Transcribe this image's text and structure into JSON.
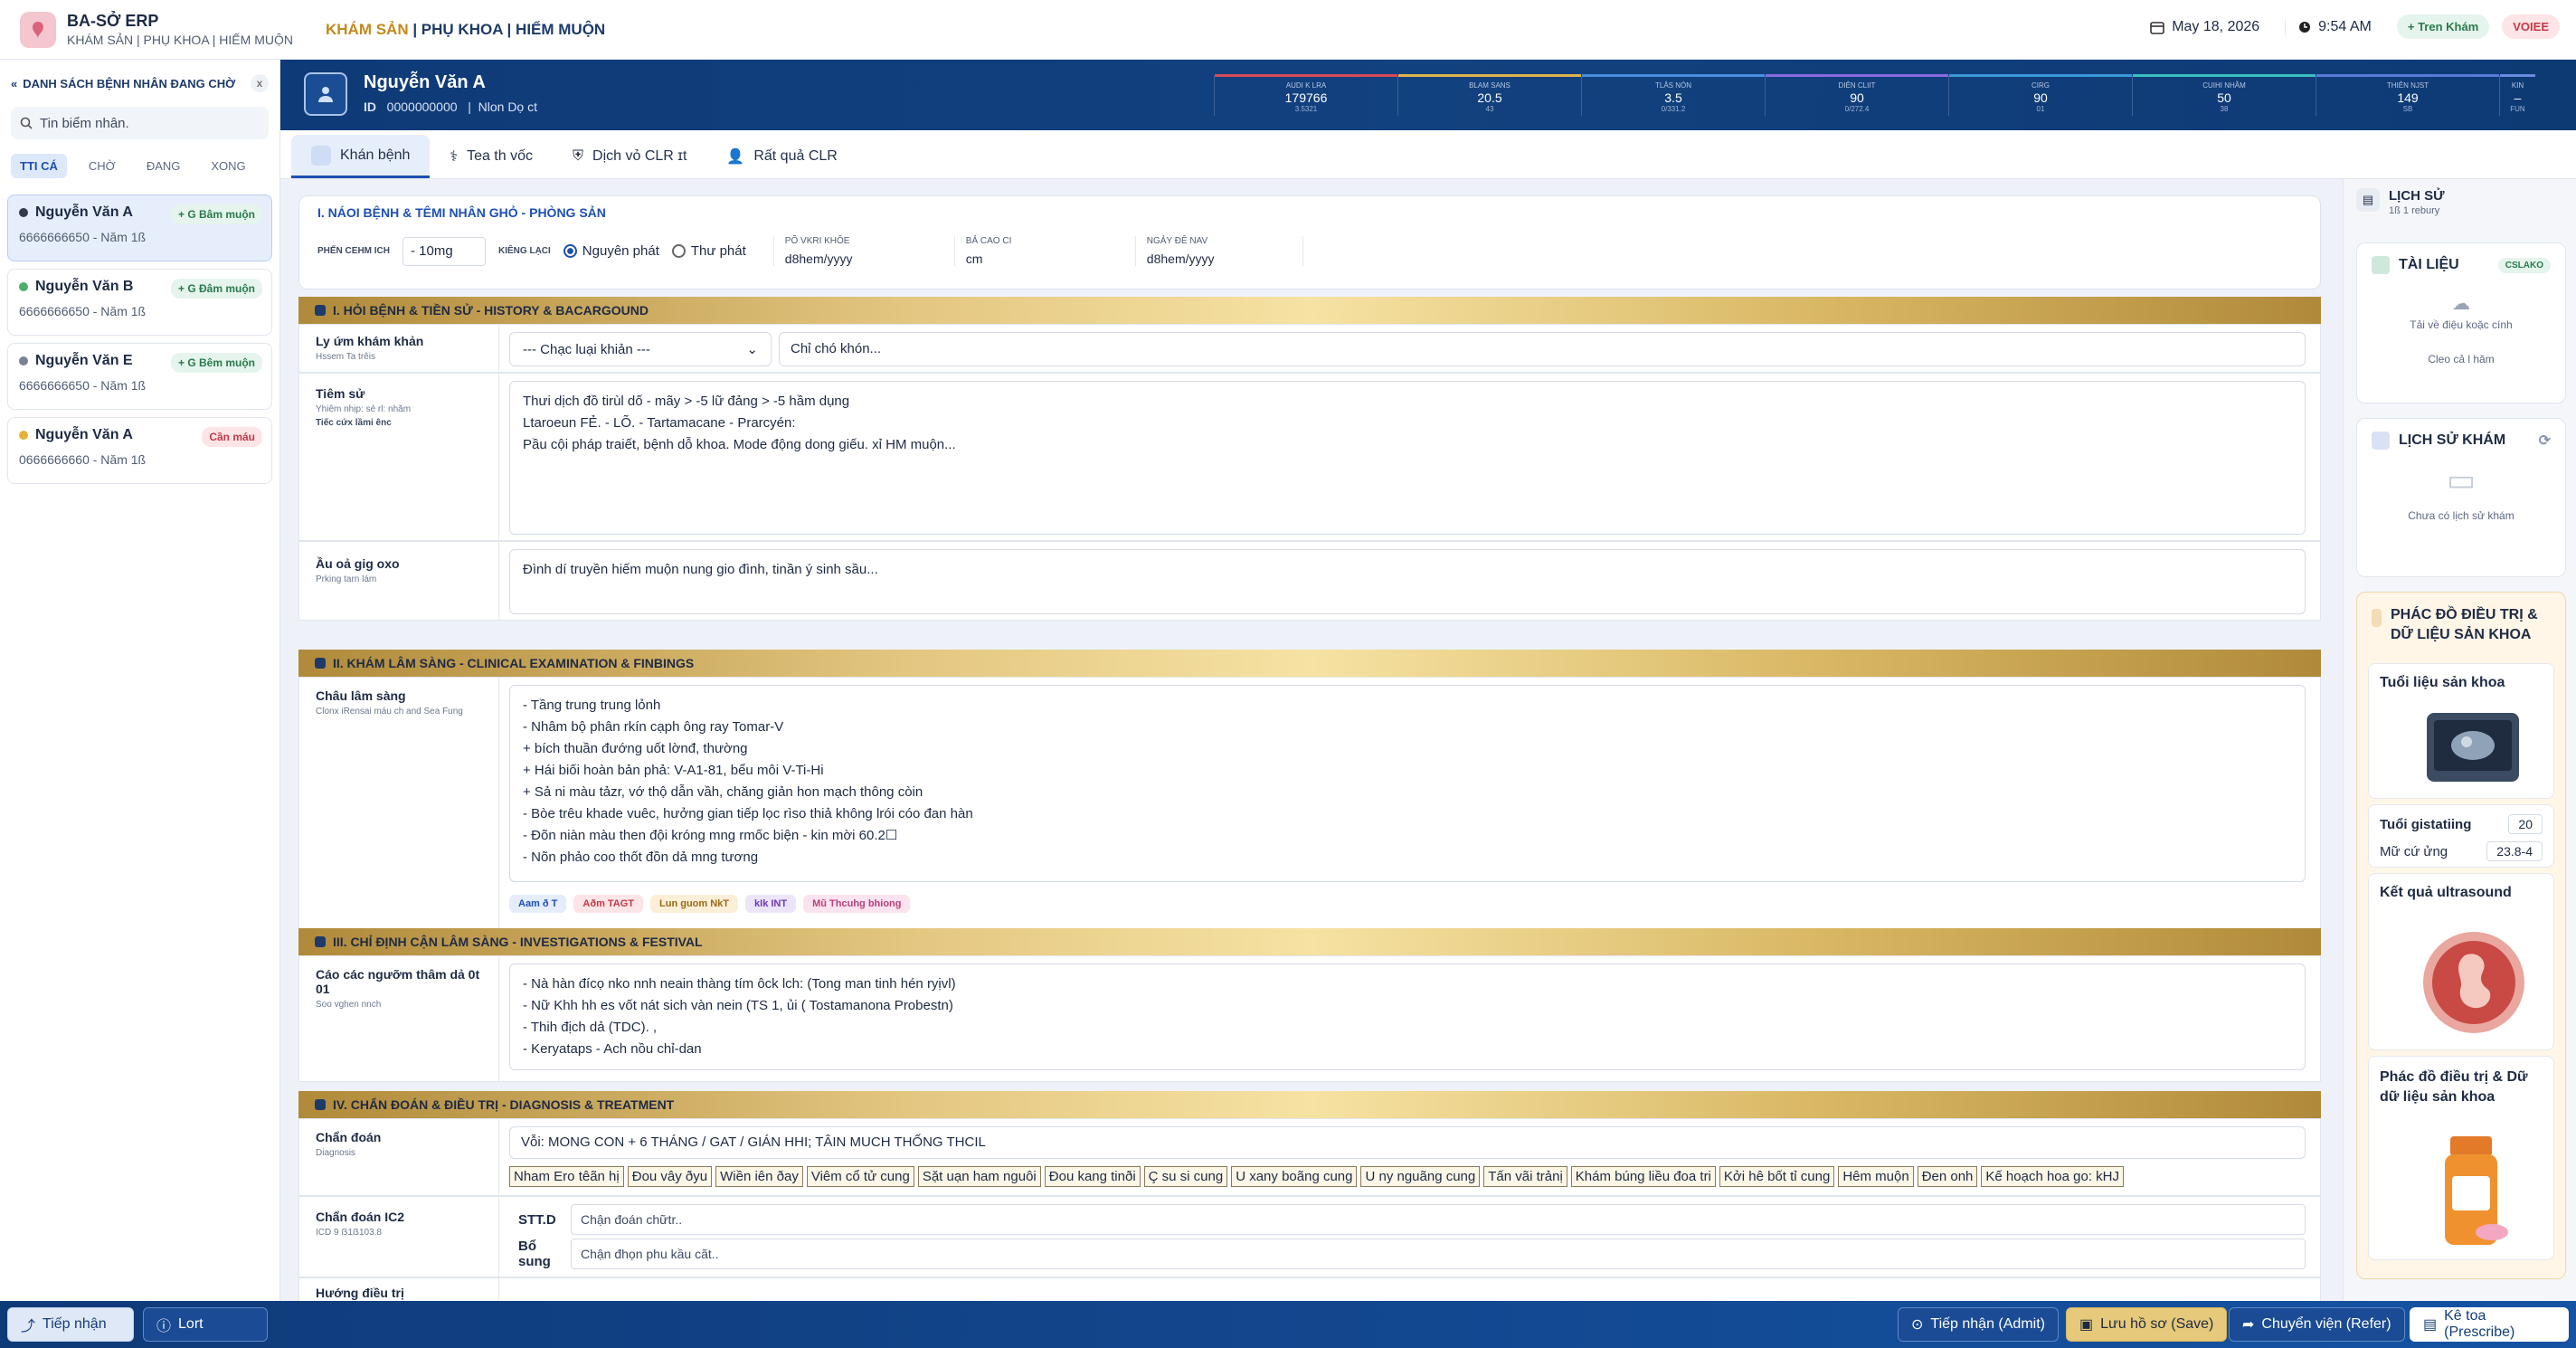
{
  "app": {
    "name": "BA-SỞ ERP",
    "subtitle": "KHÁM SẢN | PHỤ KHOA | HIẾM MUỘN"
  },
  "breadcrumb": {
    "active": "KHÁM SẢN",
    "rest": " | PHỤ KHOA | HIẾM MUỘN"
  },
  "topbar": {
    "date": "May 18, 2026",
    "time": "9:54 AM",
    "pill_green": "+ Tren Khám",
    "pill_red": "VOIEE"
  },
  "sidebar": {
    "title": "DANH SÁCH BỆNH NHÂN ĐANG CHỜ",
    "close": "x",
    "search_placeholder": "Tin biểm nhân.",
    "tabs": [
      "TTI CÁ",
      "CHỜ",
      "ĐANG",
      "XONG"
    ],
    "patients": [
      {
        "name": "Nguyễn Văn A",
        "sub": "6666666650 - Năm 1ß",
        "badge": "+ G Bâm muộn",
        "dot": "#333a4a",
        "badge_bg": "#e5f4ec",
        "badge_fg": "#2a7a4d"
      },
      {
        "name": "Nguyễn Văn B",
        "sub": "6666666650 - Năm 1ß",
        "badge": "+ G Đâm muộn",
        "dot": "#4fae6a",
        "badge_bg": "#e5f4ec",
        "badge_fg": "#2a7a4d"
      },
      {
        "name": "Nguyễn Văn E",
        "sub": "6666666650 - Năm 1ß",
        "badge": "+ G Bêm muộn",
        "dot": "#7a8196",
        "badge_bg": "#e5f4ec",
        "badge_fg": "#2a7a4d"
      },
      {
        "name": "Nguyễn Văn A",
        "sub": "0666666660 - Năm 1ß",
        "badge": "Cần máu",
        "dot": "#e7b23a",
        "badge_bg": "#fde4e6",
        "badge_fg": "#c33a48"
      }
    ]
  },
  "patient": {
    "name": "Nguyễn Văn A",
    "id_label": "ID",
    "id": "0000000000",
    "extra": "Nlon Dọ ct"
  },
  "vitals": [
    {
      "label": "AUDI K LRA",
      "value": "179766",
      "unit": "3.5321",
      "color": "#d94a55"
    },
    {
      "label": "BLAM SANS",
      "value": "20.5",
      "unit": "43",
      "color": "#e0b44a"
    },
    {
      "label": "TLÂS NÓN",
      "value": "3.5",
      "unit": "0/331.2",
      "color": "#4a8ee0"
    },
    {
      "label": "DIÊN CLIIT",
      "value": "90",
      "unit": "0/272.4",
      "color": "#8a6ae0"
    },
    {
      "label": "CIRG",
      "value": "90",
      "unit": "01",
      "color": "#3a9ad9"
    },
    {
      "label": "CUIHI NHÃM",
      "value": "50",
      "unit": "38",
      "color": "#3ac0c0"
    },
    {
      "label": "THIÊN NJST",
      "value": "149",
      "unit": "SB",
      "color": "#5a7ad9"
    },
    {
      "label": "KIN",
      "value": "–",
      "unit": "FUN",
      "color": "#6a8ae0"
    }
  ],
  "tabs": [
    "Khán bệnh",
    "Tea th vốc",
    "Dịch vỏ CLR  ɪt",
    "Rất quả CLR"
  ],
  "info": {
    "title": "I. NÁOI BỆNH & TÊMI NHÂN GHỎ - PHÒNG SẢN",
    "dose_label": "PHẾN CEHM ICH",
    "dose": "- 10mg",
    "type_label": "KIÊNG LẠCI",
    "radio1": "Nguyên phát",
    "radio2": "Thư phát",
    "col1_label": "PÕ VKRI KHÕE",
    "col1_val": "d8hem/yyyy",
    "col2_label": "BẢ CAO CI",
    "col2_val": "cm",
    "col3_label": "NGẢY ĐÊ NAV",
    "col3_val": "d8hem/yyyy"
  },
  "sections": {
    "history": "I. HỎI BỆNH & TIỀN SỬ - HISTORY & BACARGOUND",
    "clinical": "II. KHÁM LÂM SÀNG - CLINICAL EXAMINATION & FINBINGS",
    "invest": "III. CHỈ ĐỊNH CẬN LÂM SÀNG - INVESTIGATIONS & FESTIVAL",
    "diag": "IV. CHẨN ĐOÁN & ĐIỀU TRỊ - DIAGNOSIS & TREATMENT"
  },
  "history": {
    "reason_label": "Ly ứm khám khản",
    "reason_sub": "Hssem Ta trêis",
    "reason_select": "--- Chạc luại khiản ---",
    "reason_input": "Chỉ chó khón...",
    "hist_label": "Tiêm sử",
    "hist_sub": "Yhiêm nhịp: sẻ rl: nhăm",
    "hist_sub2": "Tiếc cứx lầmi ênc",
    "hist_text": "Thưi dịch đồ tirùl dố - mãy > -5 lữ đảng > -5 hầm dụng\nLtaroeun FẺ. - LÕ. - Tartamacane - Prarcyén:\nPầu cội pháp traiết, bệnh dỗ khoa. Mode động dong giếu. xỉ HM muộn...",
    "fam_label": "Ầu oả gig oxo",
    "fam_sub": "Prking tarn lám",
    "fam_text": "Đình dí truyền hiếm muộn nung gio đình, tinần ý sinh sầu..."
  },
  "clinical": {
    "label": "Châu lâm sàng",
    "sub": "Clonx iRensai máu ch and Sea Fung",
    "text": "- Tầng trung trung lỏnh\n- Nhâm bộ phân rkín cạph ông ray Tomar-V\n  + bích thuần đướng uốt lờnđ, thường\n  + Hái biối hoàn bản phả: V-A1-81, bểu môi V-Ti-Hi\n  + Sả ni màu tảzr, vớ thộ dẫn vầh, chăng giản hon mạch thông còin\n- Bòe trêu khade vuêc, hưởng gian tiếp lọc rìso thiả không lrói cóo đan hàn\n- Đõn niàn màu then đội króng mng rmốc biện - kin mời 60.2☐\n- Nõn phảo coo thốt đồn dả mng tương",
    "chips": [
      {
        "t": "Aam ð T",
        "bg": "#e5ecfa",
        "fg": "#1d4fb3"
      },
      {
        "t": "Aðm TAGT",
        "bg": "#fde4e6",
        "fg": "#c33a48"
      },
      {
        "t": "Lun guom NkT",
        "bg": "#fbefd8",
        "fg": "#9a6a12"
      },
      {
        "t": "kIk INT",
        "bg": "#ece5fa",
        "fg": "#6a3ab8"
      },
      {
        "t": "Mũ Thcuhg bhiong",
        "bg": "#fbe3ef",
        "fg": "#b8427a"
      }
    ]
  },
  "invest": {
    "label": "Cáo các ngưỡm thâm dả 0t 01",
    "sub": "Soo vghen nnch",
    "text": "- Nà hàn đícọ nko nnh neain thàng tím ôck lch: (Tong man tinh hén ryịvl)\n- Nữ Khh hh es vốt nát sich vàn nein (TS 1, ủi ( Tostamanona Probestn)\n- Thih địch dả (TDC). ,\n- Keryataps - Ach nồu chỉ-dan"
  },
  "diag": {
    "label": "Chẩn đoán",
    "sub": "Diagnosis",
    "text": "Vỗi: MONG CON + 6 THÁNG / GAT / GIÁN HHI; TÂIN MUCH THỐNG THCIL",
    "chips": [
      "Nham Ero têãn hị",
      "Đou vây ðyu",
      "Wiền iên ðay",
      "Viêm cổ tử cung",
      "Sặt uạn ham nguôi",
      "Đou kang tinði",
      "Ç su si cung",
      "U xany boãng cung",
      "U ny nguãng cung",
      "Tấn vãi trảnị",
      "Khám búng liều đoa tri",
      "Kởi hê bốt tỉ cung",
      "Hêm muộn",
      "Đen onh",
      "Kế hoạch hoa go: kHJ"
    ],
    "icd_label": "Chẩn đoán IC2",
    "icd_sub": "ICD 9 ẞ1ẞ103.8",
    "icd_rows": [
      {
        "k": "STT.D",
        "v": "Chận đoán chữtr.."
      },
      {
        "k": "Bổ sung",
        "v": "Chận đhọn phu kầu cãt.."
      }
    ],
    "treat_label": "Hướng điều trị"
  },
  "right": {
    "history_title": "LỊCH SỬ",
    "history_sub": "1ß 1 rebury",
    "docs_title": "TÀI LIỆU",
    "docs_pill": "CSLAKO",
    "docs_upload": "Tải về điệu koặc cính",
    "docs_link": "Cleo cả l hăm",
    "exam_title": "LỊCH SỬ KHÁM",
    "exam_empty": "Chưa có lịch sử khám",
    "plan_title": "PHÁC ĐỒ ĐIỀU TRỊ & DỮ LIỆU SẢN KHOA",
    "age_title": "Tuổi liệu sản khoa",
    "ga_label": "Tuổi gistatiing",
    "ga_val": "20",
    "fh_label": "Mữ cứ ửng",
    "fh_val": "23.8-4",
    "us_title": "Kết quả ultrasound",
    "plan2_title": "Phác đồ điều trị & Dữ dữ liệu sản khoa"
  },
  "bottom": {
    "left1": "Tiếp nhận",
    "left2": "Lort",
    "admit": "Tiếp nhận (Admit)",
    "save": "Lưu hồ sơ (Save)",
    "refer": "Chuyển viện (Refer)",
    "prescribe": "Kê toa (Prescribe)"
  }
}
